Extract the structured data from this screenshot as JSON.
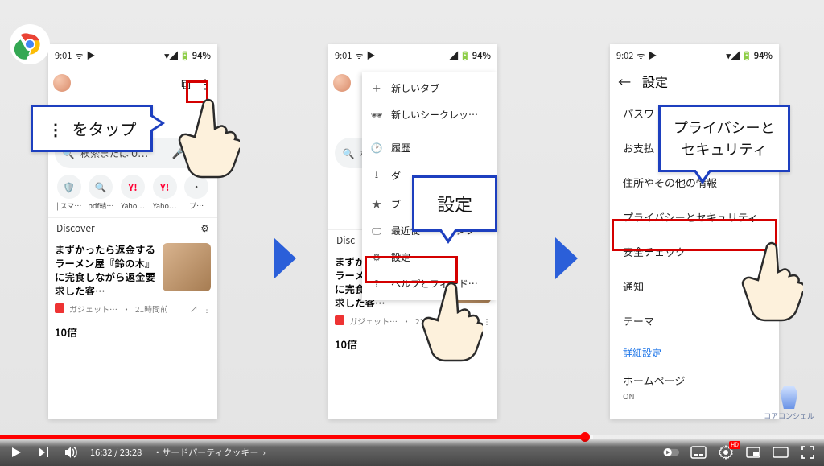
{
  "status": {
    "time1": "9:01",
    "time2": "9:01",
    "time3": "9:02",
    "battery": "94%"
  },
  "phone1": {
    "search_placeholder": "検索または U…",
    "shortcuts": [
      "| スマ…",
      "pdf結…",
      "Yaho…",
      "Yaho…",
      "プ…"
    ],
    "discover": "Discover",
    "article_title": "まずかったら返金するラーメン屋『鈴の木』に完食しながら返金要求した客…",
    "article_source": "ガジェット…",
    "article_time": "21時間前",
    "article2_title": "10倍"
  },
  "phone2": {
    "menu": {
      "new_tab": "新しいタブ",
      "incognito": "新しいシークレッ…",
      "history": "履歴",
      "downloads": "ダ",
      "bookmarks": "ブ",
      "recent": "最近使",
      "recent_suffix": "タブ",
      "settings": "設定",
      "help": "ヘルプとフィード…"
    },
    "discover": "Disc",
    "article_title": "まずかったら返金するラーメン屋『鈴の木』に完食しながら返金要求した客…",
    "article_source": "ガジェット…",
    "article_time": "21時間前",
    "article2_title": "10倍"
  },
  "phone3": {
    "title": "設定",
    "items": {
      "password": "パスワ",
      "payment": "お支払",
      "addresses": "住所やその他の情報",
      "privacy": "プライバシーとセキュリティ",
      "safety": "安全チェック",
      "notifications": "通知",
      "theme": "テーマ",
      "advanced": "詳細設定",
      "homepage": "ホームページ",
      "homepage_sub": "ON"
    }
  },
  "callouts": {
    "c1_prefix": "⋮",
    "c1": " をタップ",
    "c2": "設定",
    "c3_l1": "プライバシーと",
    "c3_l2": "セキュリティ"
  },
  "watermark": "コアコンシェル",
  "player": {
    "current": "16:32",
    "total": "23:28",
    "chapter": "サードパーティクッキー",
    "hd": "HD"
  }
}
